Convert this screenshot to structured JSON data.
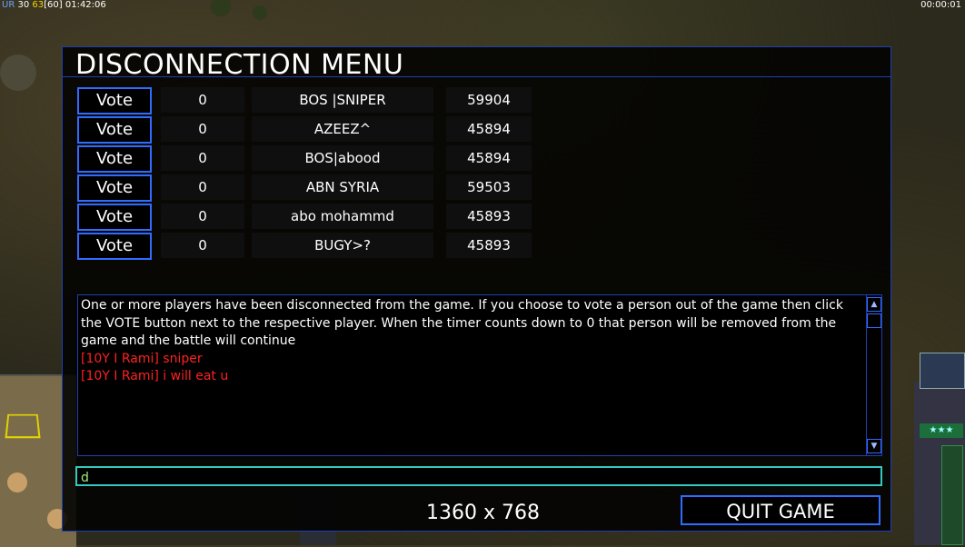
{
  "hud": {
    "ur_label": "UR",
    "stat_a": "30",
    "stat_b": "63",
    "stat_c": "[60]",
    "game_clock": "01:42:06",
    "right_clock": "00:00:01",
    "stars": "★★★"
  },
  "dialog": {
    "title": "DISCONNECTION MENU",
    "players": [
      {
        "vote_label": "Vote",
        "count": "0",
        "name": "BOS |SNIPER",
        "id": "59904"
      },
      {
        "vote_label": "Vote",
        "count": "0",
        "name": "AZEEZ^",
        "id": "45894"
      },
      {
        "vote_label": "Vote",
        "count": "0",
        "name": "BOS|abood",
        "id": "45894"
      },
      {
        "vote_label": "Vote",
        "count": "0",
        "name": "ABN SYRIA",
        "id": "59503"
      },
      {
        "vote_label": "Vote",
        "count": "0",
        "name": "abo mohammd",
        "id": "45893"
      },
      {
        "vote_label": "Vote",
        "count": "0",
        "name": "BUGY>?",
        "id": "45893"
      }
    ],
    "chat": {
      "system_message": "One or more players have been disconnected from the game. If you choose to vote a person out of the game then click the VOTE button next to the respective player. When the timer counts down to 0 that person will be removed from the game and the battle will continue",
      "messages": [
        "[10Y I Rami] sniper",
        "[10Y I Rami] i will eat u"
      ]
    },
    "input_value": "d",
    "resolution": "1360 x 768",
    "quit_label": "QUIT GAME"
  },
  "colors": {
    "border_blue": "#2f6cff",
    "chat_red": "#ff2020",
    "input_cyan": "#33c9c0"
  }
}
